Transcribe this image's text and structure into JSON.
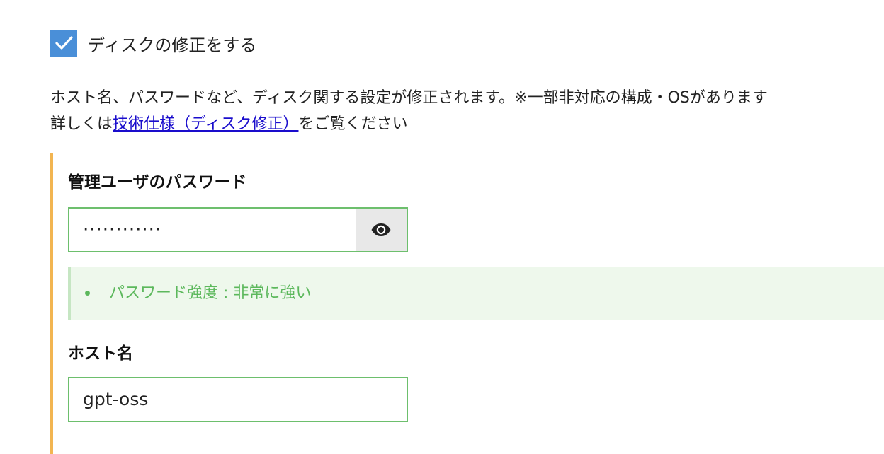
{
  "disk_fix": {
    "checkbox_label": "ディスクの修正をする",
    "checked": true,
    "description_line1": "ホスト名、パスワードなど、ディスク関する設定が修正されます。※一部非対応の構成・OSがあります",
    "description_line2_prefix": "詳しくは",
    "description_link": "技術仕様（ディスク修正）",
    "description_line2_suffix": "をご覧ください"
  },
  "password": {
    "label": "管理ユーザのパスワード",
    "masked_value": "············",
    "visibility_icon": "eye-icon",
    "strength_text": "パスワード強度 : 非常に強い"
  },
  "hostname": {
    "label": "ホスト名",
    "value": "gpt-oss"
  },
  "colors": {
    "checkbox": "#4a8fd8",
    "link": "#1a0dcc",
    "panel_accent": "#f2b551",
    "input_border": "#6dbf6d",
    "strength_text": "#5cb85c",
    "strength_bg": "#eef8ec"
  }
}
